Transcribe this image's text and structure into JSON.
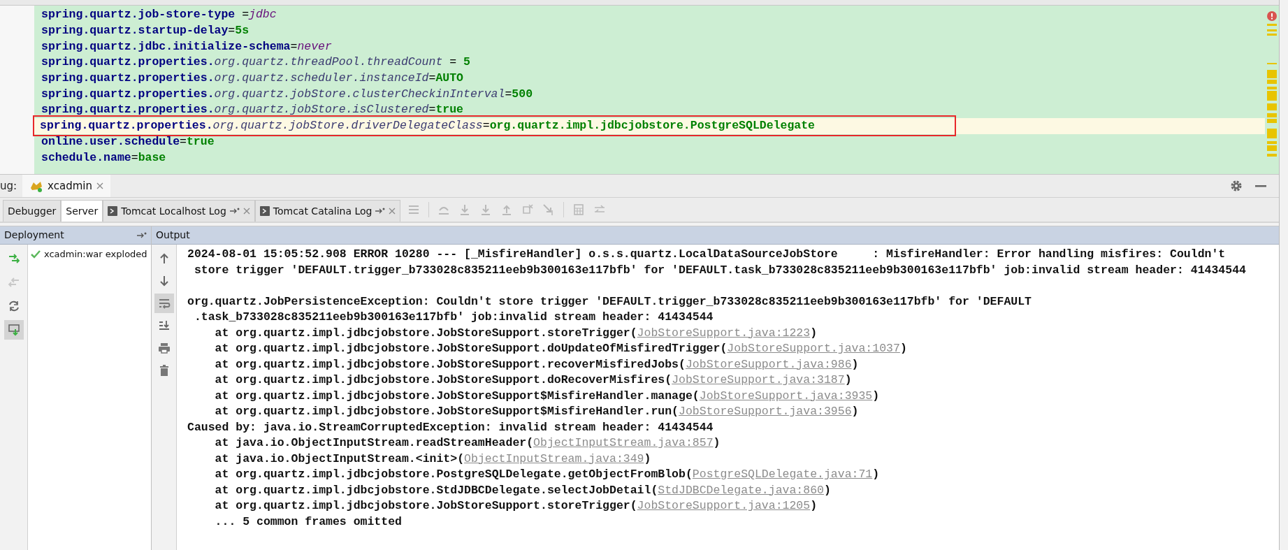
{
  "editor": {
    "lines": [
      {
        "highlighted": false,
        "segments": [
          {
            "kind": "key",
            "text": "spring.quartz.job-store-type"
          },
          {
            "kind": "sep",
            "text": " ="
          },
          {
            "kind": "enum",
            "text": "jdbc"
          }
        ]
      },
      {
        "highlighted": false,
        "segments": [
          {
            "kind": "key",
            "text": "spring.quartz.startup-delay"
          },
          {
            "kind": "sep",
            "text": "="
          },
          {
            "kind": "value",
            "text": "5s"
          }
        ]
      },
      {
        "highlighted": false,
        "segments": [
          {
            "kind": "key",
            "text": "spring.quartz.jdbc.initialize-schema"
          },
          {
            "kind": "sep",
            "text": "="
          },
          {
            "kind": "enum",
            "text": "never"
          }
        ]
      },
      {
        "highlighted": false,
        "segments": [
          {
            "kind": "key",
            "text": "spring.quartz.properties."
          },
          {
            "kind": "prop",
            "text": "org.quartz.threadPool.threadCount"
          },
          {
            "kind": "sep",
            "text": " = "
          },
          {
            "kind": "value",
            "text": "5"
          }
        ]
      },
      {
        "highlighted": false,
        "segments": [
          {
            "kind": "key",
            "text": "spring.quartz.properties."
          },
          {
            "kind": "prop",
            "text": "org.quartz.scheduler.instanceId"
          },
          {
            "kind": "sep",
            "text": "="
          },
          {
            "kind": "value",
            "text": "AUTO"
          }
        ]
      },
      {
        "highlighted": false,
        "segments": [
          {
            "kind": "key",
            "text": "spring.quartz.properties."
          },
          {
            "kind": "prop",
            "text": "org.quartz.jobStore.clusterCheckinInterval"
          },
          {
            "kind": "sep",
            "text": "="
          },
          {
            "kind": "value",
            "text": "500"
          }
        ]
      },
      {
        "highlighted": false,
        "segments": [
          {
            "kind": "key",
            "text": "spring.quartz.properties."
          },
          {
            "kind": "prop",
            "text": "org.quartz.jobStore.isClustered"
          },
          {
            "kind": "sep",
            "text": "="
          },
          {
            "kind": "value",
            "text": "true"
          }
        ]
      },
      {
        "highlighted": true,
        "segments": [
          {
            "kind": "key",
            "text": "spring.quartz.properties."
          },
          {
            "kind": "prop",
            "text": "org.quartz.jobStore.driverDelegateClass"
          },
          {
            "kind": "sep",
            "text": "="
          },
          {
            "kind": "value",
            "text": "org.quartz.impl.jdbcjobstore.PostgreSQLDelegate"
          }
        ]
      },
      {
        "highlighted": false,
        "segments": [
          {
            "kind": "key",
            "text": "online.user.schedule"
          },
          {
            "kind": "sep",
            "text": "="
          },
          {
            "kind": "value",
            "text": "true"
          }
        ]
      },
      {
        "highlighted": false,
        "segments": [
          {
            "kind": "key",
            "text": "schedule.name"
          },
          {
            "kind": "sep",
            "text": "="
          },
          {
            "kind": "value",
            "text": "base"
          }
        ]
      }
    ]
  },
  "debug_bar": {
    "label": "ug:",
    "session_tab": "xcadmin"
  },
  "tool_tabs": [
    {
      "label": "Debugger",
      "kind": "plain",
      "selected": false
    },
    {
      "label": "Server",
      "kind": "plain",
      "selected": true
    },
    {
      "label": "Tomcat Localhost Log",
      "kind": "log",
      "selected": false
    },
    {
      "label": "Tomcat Catalina Log",
      "kind": "log",
      "selected": false
    }
  ],
  "deployment": {
    "title": "Deployment",
    "items": [
      {
        "name": "xcadmin:war exploded",
        "deployed": true
      }
    ]
  },
  "output": {
    "title": "Output",
    "soft_wrap": true,
    "lines": [
      {
        "kind": "text",
        "text": "2024-08-01 15:05:52.908 ERROR 10280 --- [_MisfireHandler] o.s.s.quartz.LocalDataSourceJobStore     : MisfireHandler: Error handling misfires: Couldn't"
      },
      {
        "kind": "text",
        "text": " store trigger 'DEFAULT.trigger_b733028c835211eeb9b300163e117bfb' for 'DEFAULT.task_b733028c835211eeb9b300163e117bfb' job:invalid stream header: 41434544"
      },
      {
        "kind": "blank"
      },
      {
        "kind": "text",
        "text": "org.quartz.JobPersistenceException: Couldn't store trigger 'DEFAULT.trigger_b733028c835211eeb9b300163e117bfb' for 'DEFAULT"
      },
      {
        "kind": "text",
        "text": " .task_b733028c835211eeb9b300163e117bfb' job:invalid stream header: 41434544"
      },
      {
        "kind": "frame",
        "text": "    at org.quartz.impl.jdbcjobstore.JobStoreSupport.storeTrigger(",
        "link": "JobStoreSupport.java:1223",
        "tail": ")"
      },
      {
        "kind": "frame",
        "text": "    at org.quartz.impl.jdbcjobstore.JobStoreSupport.doUpdateOfMisfiredTrigger(",
        "link": "JobStoreSupport.java:1037",
        "tail": ")"
      },
      {
        "kind": "frame",
        "text": "    at org.quartz.impl.jdbcjobstore.JobStoreSupport.recoverMisfiredJobs(",
        "link": "JobStoreSupport.java:986",
        "tail": ")"
      },
      {
        "kind": "frame",
        "text": "    at org.quartz.impl.jdbcjobstore.JobStoreSupport.doRecoverMisfires(",
        "link": "JobStoreSupport.java:3187",
        "tail": ")"
      },
      {
        "kind": "frame",
        "text": "    at org.quartz.impl.jdbcjobstore.JobStoreSupport$MisfireHandler.manage(",
        "link": "JobStoreSupport.java:3935",
        "tail": ")"
      },
      {
        "kind": "frame",
        "text": "    at org.quartz.impl.jdbcjobstore.JobStoreSupport$MisfireHandler.run(",
        "link": "JobStoreSupport.java:3956",
        "tail": ")"
      },
      {
        "kind": "text",
        "text": "Caused by: java.io.StreamCorruptedException: invalid stream header: 41434544"
      },
      {
        "kind": "frame",
        "text": "    at java.io.ObjectInputStream.readStreamHeader(",
        "link": "ObjectInputStream.java:857",
        "tail": ")"
      },
      {
        "kind": "frame",
        "text": "    at java.io.ObjectInputStream.<init>(",
        "link": "ObjectInputStream.java:349",
        "tail": ")"
      },
      {
        "kind": "frame",
        "text": "    at org.quartz.impl.jdbcjobstore.PostgreSQLDelegate.getObjectFromBlob(",
        "link": "PostgreSQLDelegate.java:71",
        "tail": ")"
      },
      {
        "kind": "frame",
        "text": "    at org.quartz.impl.jdbcjobstore.StdJDBCDelegate.selectJobDetail(",
        "link": "StdJDBCDelegate.java:860",
        "tail": ")"
      },
      {
        "kind": "frame",
        "text": "    at org.quartz.impl.jdbcjobstore.JobStoreSupport.storeTrigger(",
        "link": "JobStoreSupport.java:1205",
        "tail": ")"
      },
      {
        "kind": "text",
        "text": "    ... 5 common frames omitted"
      }
    ]
  }
}
